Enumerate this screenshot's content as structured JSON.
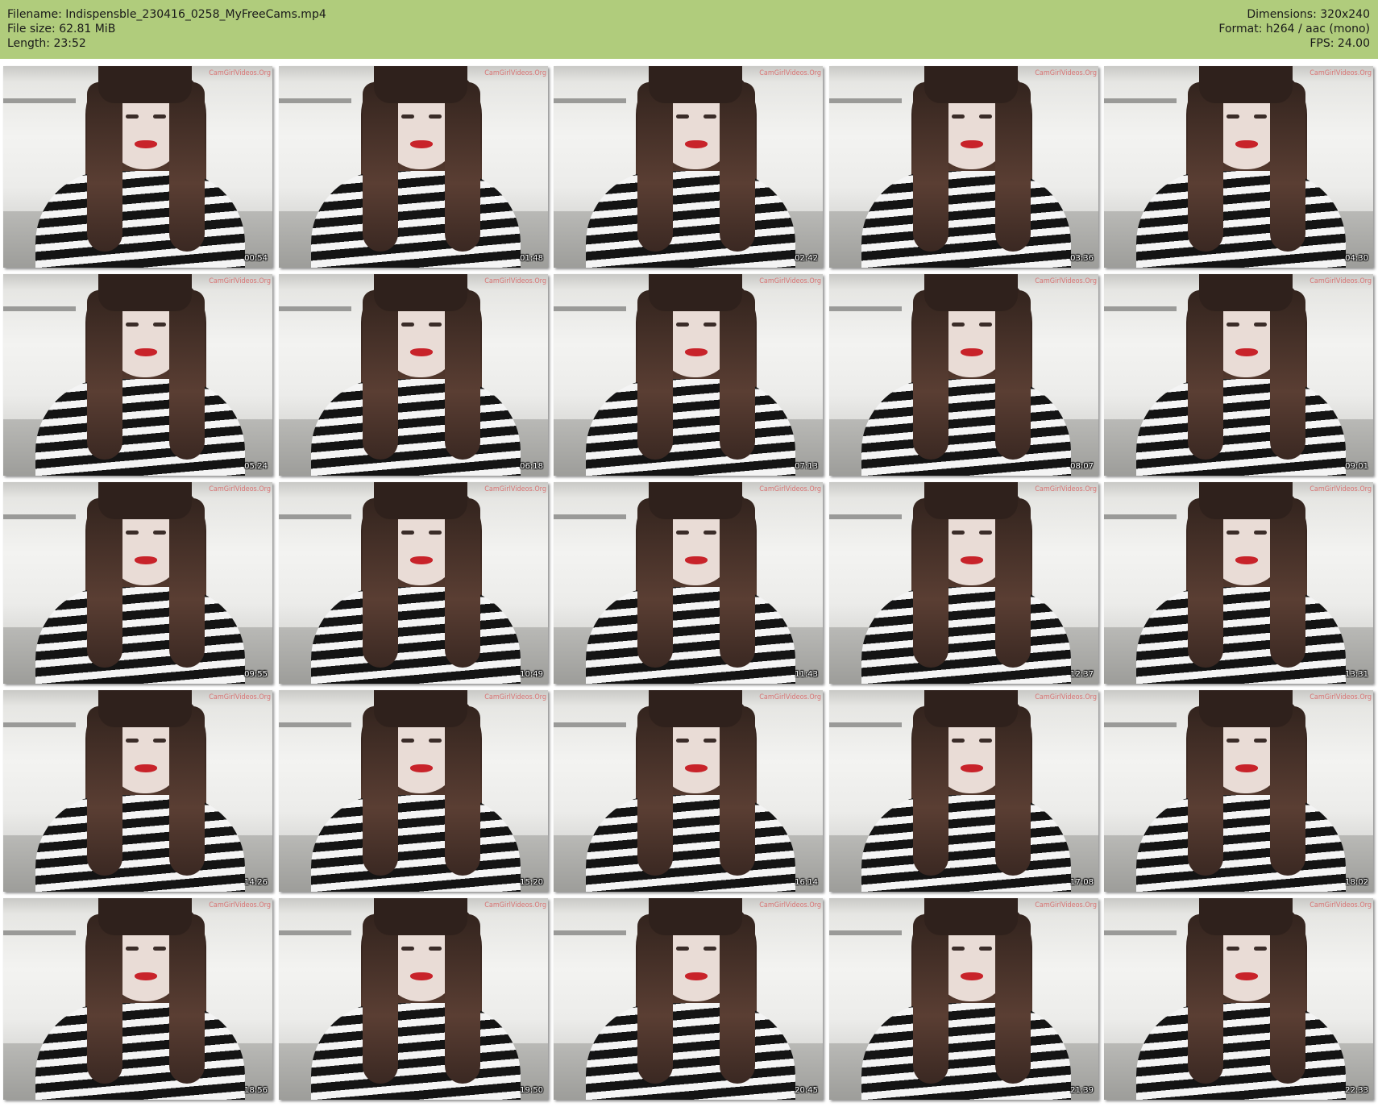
{
  "header": {
    "filename": "Filename: Indispensble_230416_0258_MyFreeCams.mp4",
    "filesize": "File size: 62.81 MiB",
    "length": "Length: 23:52",
    "dimensions": "Dimensions: 320x240",
    "format": "Format: h264 / aac (mono)",
    "fps": "FPS: 24.00"
  },
  "colors": {
    "header_bg": "#b0cc7c"
  },
  "watermark": "CamGirlVideos.Org",
  "timestamps": [
    "00:54",
    "01:48",
    "02:42",
    "03:36",
    "04:30",
    "05:24",
    "06:18",
    "07:13",
    "08:07",
    "09:01",
    "09:55",
    "10:49",
    "11:43",
    "12:37",
    "13:31",
    "14:26",
    "15:20",
    "16:14",
    "17:08",
    "18:02",
    "18:56",
    "19:50",
    "20:45",
    "21:39",
    "22:33"
  ]
}
